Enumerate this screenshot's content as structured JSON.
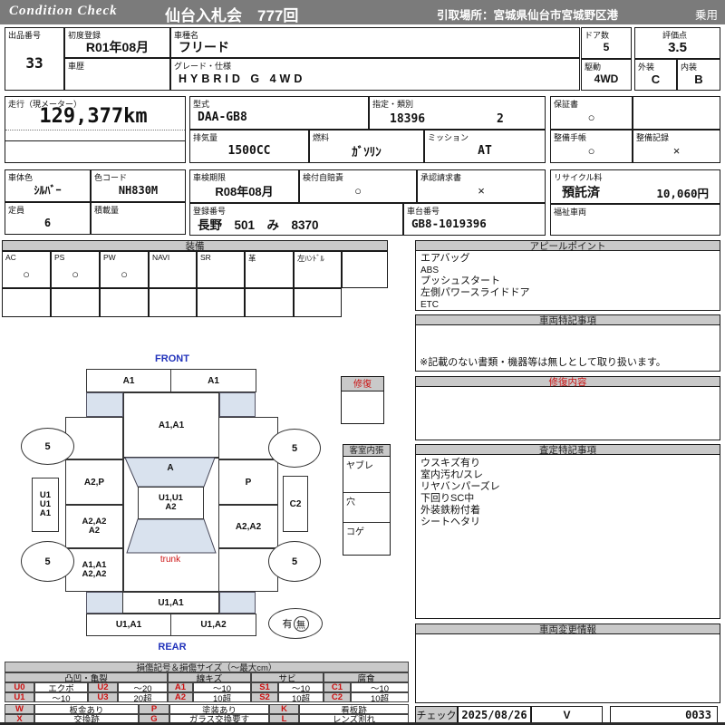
{
  "header": {
    "brand": "Condition  Check",
    "title": "仙台入札会　777回",
    "pickup": "引取場所：宮城県仙台市宮城野区港",
    "usage": "乗用"
  },
  "info": {
    "lot_label": "出品番号",
    "lot": "33",
    "first_reg_label": "初度登録",
    "first_reg": "R01年08月",
    "history_label": "車歴",
    "model_label": "車種名",
    "model": "フリード",
    "grade_label": "グレード・仕様",
    "grade": "HYBRID G 4WD",
    "doors_label": "ドア数",
    "doors": "5",
    "score_label": "評価点",
    "score": "3.5",
    "drive_label": "駆動",
    "drive": "4WD",
    "exterior_label": "外装",
    "exterior": "C",
    "interior_label": "内装",
    "interior": "B",
    "mileage_label": "走行（現メーター）",
    "mileage": "129,377km",
    "model_code_label": "型式",
    "model_code": "DAA-GB8",
    "class_label": "指定・類別",
    "class_no": "18396",
    "class_sub": "2",
    "displacement_label": "排気量",
    "displacement": "1500CC",
    "fuel_label": "燃料",
    "fuel": "ｶﾞｿﾘﾝ",
    "transmission_label": "ミッション",
    "transmission": "AT",
    "warranty_label": "保証書",
    "warranty": "○",
    "service_book_label": "整備手帳",
    "service_book": "○",
    "service_record_label": "整備記録",
    "service_record": "×",
    "body_color_label": "車体色",
    "body_color": "ｼﾙﾊﾞｰ",
    "color_code_label": "色コード",
    "color_code": "NH830M",
    "inspection_label": "車検期限",
    "inspection": "R08年08月",
    "jibaiseki_label": "検付自賠責",
    "jibaiseki": "○",
    "approval_label": "承認請求書",
    "approval": "×",
    "capacity_label": "定員",
    "capacity": "6",
    "payload_label": "積載量",
    "reg_number_label": "登録番号",
    "reg_number": "長野　501　み　8370",
    "chassis_label": "車台番号",
    "chassis": "GB8-1019396",
    "recycle_label": "リサイクル料",
    "recycle_status": "預託済",
    "recycle_fee": "10,060円",
    "welfare_label": "福祉車両"
  },
  "equipment": {
    "title": "装備",
    "items": [
      {
        "label": "AC",
        "value": "○"
      },
      {
        "label": "PS",
        "value": "○"
      },
      {
        "label": "PW",
        "value": "○"
      },
      {
        "label": "NAVI",
        "value": ""
      },
      {
        "label": "SR",
        "value": ""
      },
      {
        "label": "革",
        "value": ""
      },
      {
        "label": "左ﾊﾝﾄﾞﾙ",
        "value": ""
      },
      {
        "label": "",
        "value": ""
      }
    ]
  },
  "appeal": {
    "title": "アピールポイント",
    "lines": [
      "エアバッグ",
      "ABS",
      "プッシュスタート",
      "左側パワースライドドア",
      "ETC"
    ]
  },
  "vehicle_notes": {
    "title": "車両特記事項",
    "note": "※記載のない書類・機器等は無しとして取り扱います。"
  },
  "repair_details": {
    "title": "修復内容"
  },
  "assessment_notes": {
    "title": "査定特記事項",
    "lines": [
      "ウスキズ有り",
      "室内汚れ/スレ",
      "リヤバンパーズレ",
      "下回りSC中",
      "外装鉄粉付着",
      "シートヘタリ"
    ]
  },
  "change_info": {
    "title": "車両変更情報"
  },
  "check": {
    "label": "チェック",
    "date": "2025/08/26",
    "inspector": "V",
    "sheet_no": "0033"
  },
  "diagram": {
    "front_label": "FRONT",
    "rear_label": "REAR",
    "trunk_label": "trunk",
    "wheel": "5",
    "front_bumper_left": "A1",
    "front_bumper_right": "A1",
    "hood": "A1,A1",
    "windshield": "A",
    "left_front_door": "A2,P",
    "left_slide_door": "A2,A2\nA2",
    "left_quarter": "A1,A1\nA2,A2",
    "right_front_door": "P",
    "right_slide_door": "A2,A2",
    "left_sill": "U1\nU1\nA1",
    "right_sill": "C2",
    "roof": "U1,U1\nA2",
    "rear_gate": "U1,A1",
    "rear_bumper_left": "U1,A1",
    "rear_bumper_right": "U1,A2",
    "repair_history_yes": "有",
    "repair_history_no": "無",
    "repair_box_title": "修復",
    "interior_box_title": "客室内張",
    "interior_rows": [
      "ヤブレ",
      "穴",
      "コゲ"
    ]
  },
  "legend": {
    "title": "損傷記号＆損傷サイズ（～最大cm）",
    "groups": [
      "凸凹・亀裂",
      "線キズ",
      "サビ",
      "腐食"
    ],
    "r1": [
      "U0",
      "エクボ",
      "U2",
      "～20",
      "A1",
      "～10",
      "S1",
      "～10",
      "C1",
      "～10"
    ],
    "r2": [
      "U1",
      "～10",
      "U3",
      "20超",
      "A2",
      "10超",
      "S2",
      "10超",
      "C2",
      "10超"
    ],
    "r3": [
      "W",
      "板金あり",
      "P",
      "塗装あり",
      "K",
      "看板跡"
    ],
    "r4": [
      "X",
      "交換跡",
      "G",
      "ガラス交換要す",
      "L",
      "レンズ割れ"
    ]
  },
  "colors": {
    "header_gray": "#7b7b7b",
    "title_bar_gray": "#c9c9c9",
    "accent_red": "#cc1111",
    "accent_blue": "#2233bb",
    "shade_blue": "#d9e2ee"
  }
}
